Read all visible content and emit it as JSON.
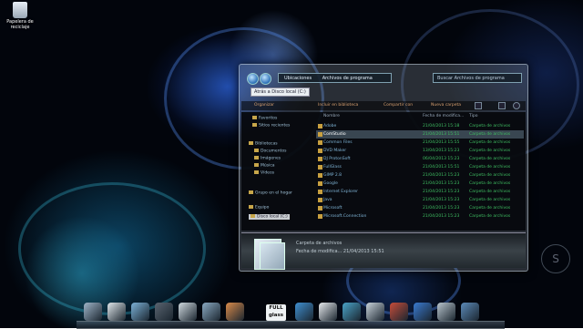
{
  "desktop": {
    "recycle_bin_label": "Papelera de reciclaje"
  },
  "explorer": {
    "breadcrumb": [
      "Ubicaciones",
      "Archivos de programa"
    ],
    "search_placeholder": "Buscar Archivos de programa",
    "tooltip": "Atrás a Disco local (C:)",
    "toolbar": {
      "organize": "Organizar",
      "include": "Incluir en biblioteca",
      "share": "Compartir con",
      "new_folder": "Nueva carpeta"
    },
    "columns": {
      "name": "Nombre",
      "date": "Fecha de modifica...",
      "type": "Tipo"
    },
    "sidebar": {
      "favorites": [
        "Favoritos",
        "Sitios recientes"
      ],
      "libraries": [
        "Bibliotecas",
        "Documentos",
        "Imágenes",
        "Música",
        "Vídeos"
      ],
      "homegroup": "Grupo en el hogar",
      "computer": "Equipo",
      "disk": "Disco local (C:)"
    },
    "files": [
      {
        "name": "Adobe",
        "date": "21/04/2013 15:18",
        "type": "Carpeta de archivos",
        "selected": false
      },
      {
        "name": "ComStudio",
        "date": "21/04/2013 15:51",
        "type": "Carpeta de archivos",
        "selected": true
      },
      {
        "name": "Common Files",
        "date": "21/04/2013 15:55",
        "type": "Carpeta de archivos",
        "selected": false
      },
      {
        "name": "DVD Maker",
        "date": "13/04/2013 15:23",
        "type": "Carpeta de archivos",
        "selected": false
      },
      {
        "name": "DJ ProtonSoft",
        "date": "06/04/2013 15:23",
        "type": "Carpeta de archivos",
        "selected": false
      },
      {
        "name": "FullGlass",
        "date": "21/04/2013 15:51",
        "type": "Carpeta de archivos",
        "selected": false
      },
      {
        "name": "GIMP 2.8",
        "date": "21/04/2013 15:23",
        "type": "Carpeta de archivos",
        "selected": false
      },
      {
        "name": "Google",
        "date": "21/04/2013 15:23",
        "type": "Carpeta de archivos",
        "selected": false
      },
      {
        "name": "Internet Explorer",
        "date": "21/04/2013 15:23",
        "type": "Carpeta de archivos",
        "selected": false
      },
      {
        "name": "Java",
        "date": "21/04/2013 15:23",
        "type": "Carpeta de archivos",
        "selected": false
      },
      {
        "name": "Microsoft",
        "date": "21/04/2013 15:23",
        "type": "Carpeta de archivos",
        "selected": false
      },
      {
        "name": "Microsoft.Connection",
        "date": "21/04/2013 15:23",
        "type": "Carpeta de archivos",
        "selected": false
      }
    ],
    "details": {
      "type": "Carpeta de archivos",
      "modified": "Fecha de modifica... 21/04/2013 15:51"
    }
  },
  "dock": {
    "fullglass_label": "FULL glass",
    "icons": [
      "computer-icon",
      "document-icon",
      "folder-icon",
      "user-icon",
      "text-icon",
      "image-icon",
      "paint-icon",
      "globe-icon",
      "note-icon",
      "network-icon",
      "gear-icon",
      "chart-icon",
      "media-icon",
      "phone-icon",
      "clock-icon"
    ]
  },
  "watermark": "S"
}
